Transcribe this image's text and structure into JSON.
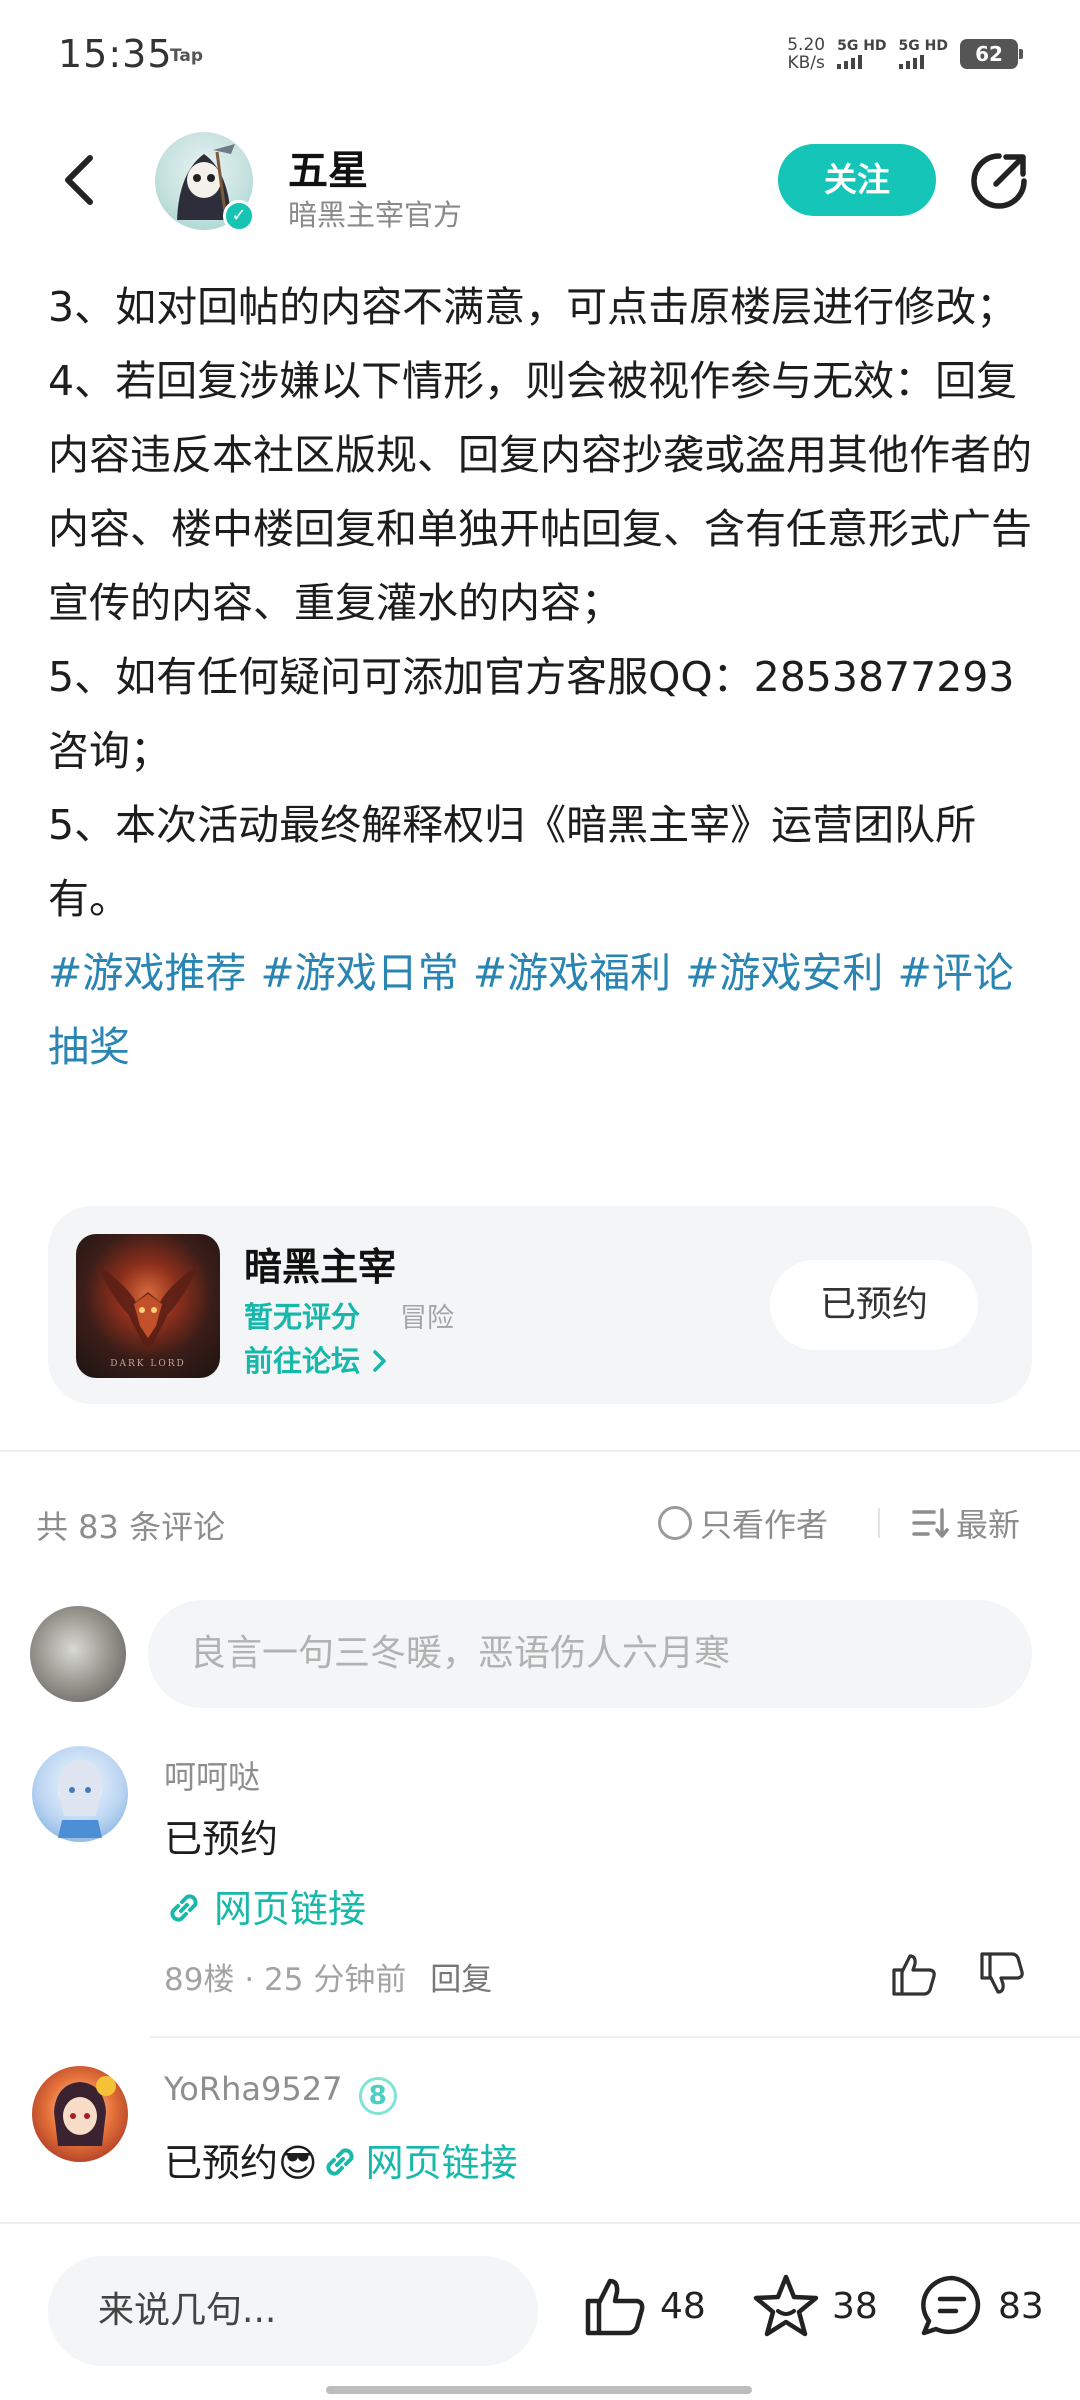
{
  "status": {
    "time": "15:35",
    "tap": "Tap",
    "speed_value": "5.20",
    "speed_unit": "KB/s",
    "sim1": "5G HD",
    "sim2": "5G HD",
    "battery": "62"
  },
  "header": {
    "author_name": "五星",
    "author_sub": "暗黑主宰官方",
    "follow_label": "关注",
    "back_icon": "chevron-left-icon",
    "share_icon": "share-icon"
  },
  "article": {
    "lines": [
      "3、如对回帖的内容不满意，可点击原楼层进行修改；",
      "4、若回复涉嫌以下情形，则会被视作参与无效：回复内容违反本社区版规、回复内容抄袭或盗用其他作者的内容、楼中楼回复和单独开帖回复、含有任意形式广告宣传的内容、重复灌水的内容；",
      "5、如有任何疑问可添加官方客服QQ：2853877293咨询；",
      "5、本次活动最终解释权归《暗黑主宰》运营团队所有。"
    ],
    "tags": [
      "#游戏推荐",
      "#游戏日常",
      "#游戏福利",
      "#游戏安利",
      "#评论抽奖"
    ]
  },
  "game": {
    "name": "暗黑主宰",
    "rating": "暂无评分",
    "genre": "冒险",
    "forum_link": "前往论坛",
    "reserve_label": "已预约",
    "icon_text": "DARK LORD"
  },
  "comments_header": {
    "count": "共 83 条评论",
    "author_only": "只看作者",
    "sort": "最新"
  },
  "comment_input": {
    "placeholder": "良言一句三冬暖，恶语伤人六月寒"
  },
  "comments": [
    {
      "user": "呵呵哒",
      "text": "已预约",
      "link": "网页链接",
      "floor": "89楼",
      "time": "25 分钟前",
      "reply": "回复"
    },
    {
      "user": "YoRha9527",
      "level": "8",
      "text": "已预约😎",
      "link": "网页链接"
    }
  ],
  "bottom_bar": {
    "say_placeholder": "来说几句...",
    "likes": "48",
    "favorites": "38",
    "comments": "83"
  },
  "colors": {
    "accent": "#15c5b8",
    "tag_blue": "#2a85b3",
    "link_teal": "#18b9ab"
  }
}
